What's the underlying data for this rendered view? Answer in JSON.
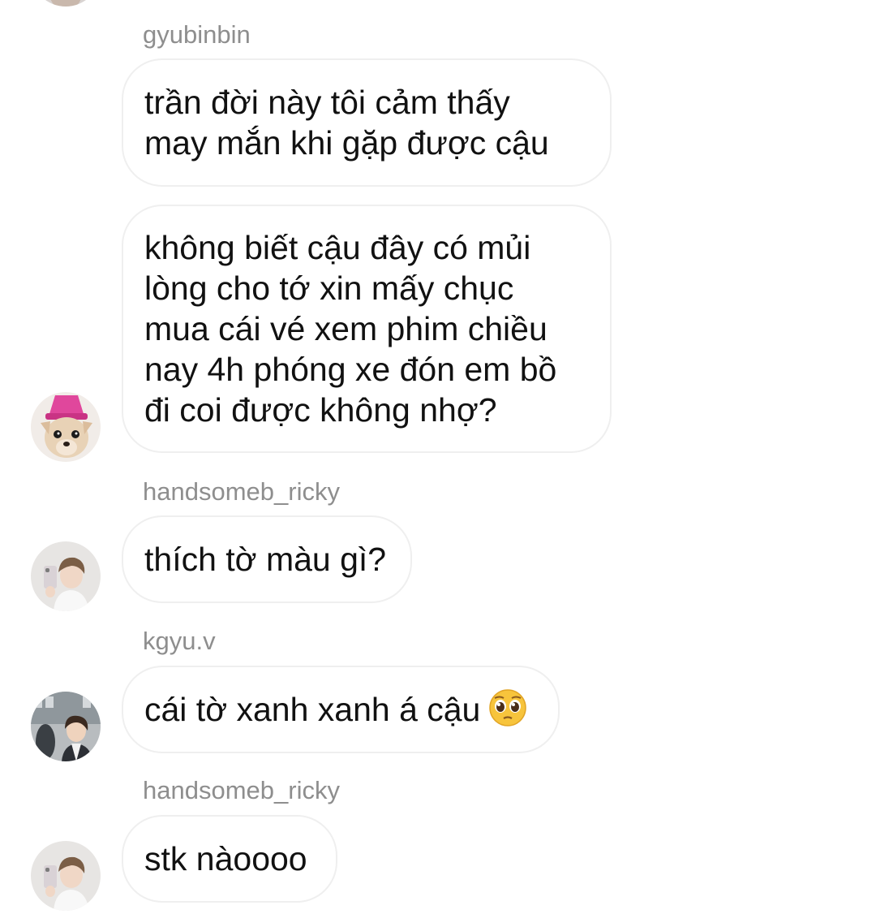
{
  "messages": [
    {
      "username": "gyubinbin",
      "bubbles": [
        "trần đời này tôi cảm thấy\nmay mắn khi gặp được cậu",
        "không biết cậu đây có mủi\nlòng cho tớ xin mấy chục\nmua cái vé xem phim chiều\nnay 4h phóng xe đón em bồ\nđi coi được không nhợ?"
      ],
      "avatar": "chihuahua-pink-hat-avatar"
    },
    {
      "username": "handsomeb_ricky",
      "bubbles": [
        "thích tờ màu gì?"
      ],
      "avatar": "mirror-selfie-avatar"
    },
    {
      "username": "kgyu.v",
      "bubbles": [
        "cái tờ xanh xanh á cậu"
      ],
      "emoji": "pleading-face-emoji",
      "avatar": "outdoor-portrait-avatar"
    },
    {
      "username": "handsomeb_ricky",
      "bubbles": [
        "stk nàoooo"
      ],
      "avatar": "mirror-selfie-avatar"
    }
  ],
  "colors": {
    "username": "#8e8e8e",
    "bubble_border": "#efefef",
    "text": "#111111",
    "emoji": "#f7c43c"
  }
}
